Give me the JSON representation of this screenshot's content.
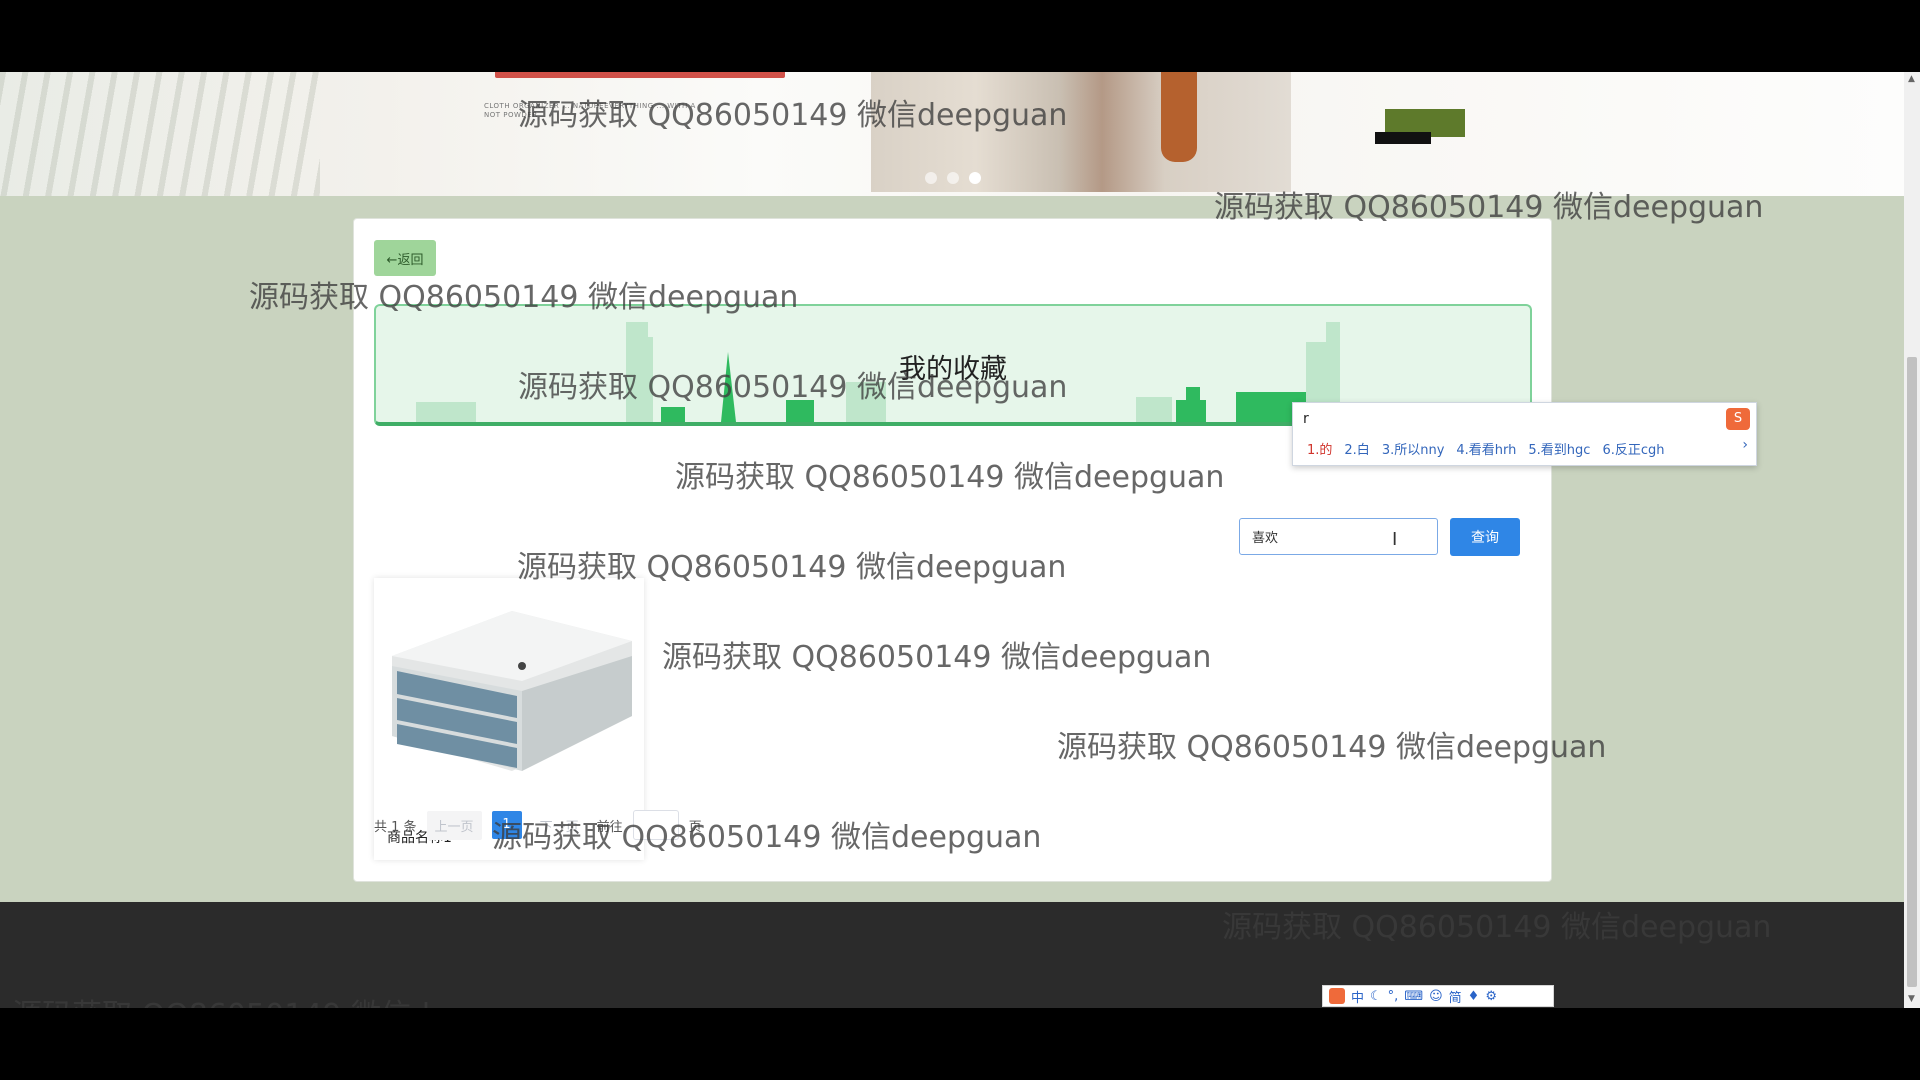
{
  "banner": {
    "promo_small": "CLOTH ORGANIZER ... NATUREEVERYTHING ... WITH A NOT POWDER",
    "slide_count": 3,
    "active_slide": 3
  },
  "page": {
    "back_label": "←返回",
    "title": "我的收藏"
  },
  "search": {
    "value": "喜欢",
    "button_label": "查询"
  },
  "products": [
    {
      "name": "商品名称1"
    }
  ],
  "pagination": {
    "total_text": "共 1 条",
    "prev_label": "上一页",
    "current_page": "1",
    "next_label": "下一页",
    "goto_label": "前往",
    "page_unit": "页"
  },
  "ime": {
    "composition": "r",
    "candidates": [
      "1.的",
      "2.白",
      "3.所以nny",
      "4.看看hrh",
      "5.看到hgc",
      "6.反正cgh"
    ],
    "toolbar_items": [
      "中",
      "简"
    ]
  },
  "watermark": "源码获取 QQ86050149 微信deepguan",
  "colors": {
    "back_button": "#9fd59a",
    "search_button": "#2f86e6",
    "title_border": "#3fae66",
    "page_background": "#c9d3bf",
    "footer": "#2b2b2b"
  }
}
